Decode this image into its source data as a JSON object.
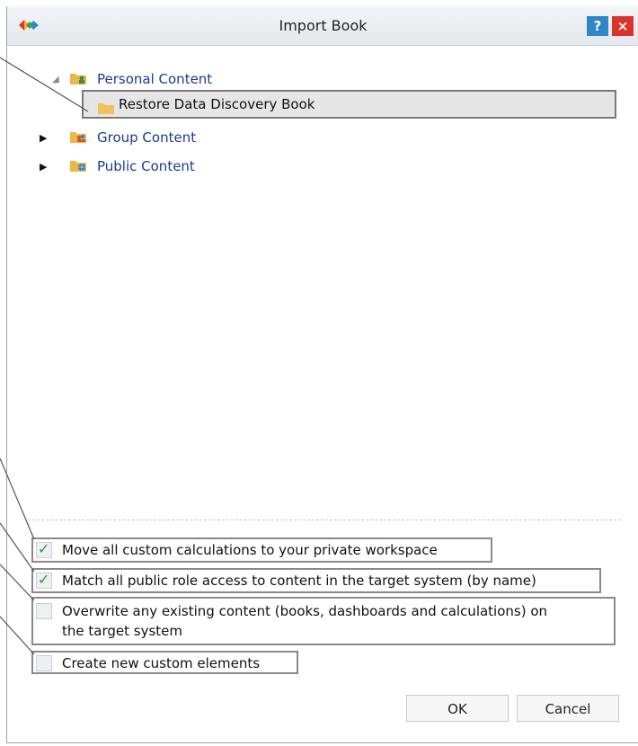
{
  "dialog": {
    "title": "Import Book"
  },
  "titlebar": {
    "help_label": "?",
    "close_label": "×"
  },
  "tree": {
    "items": [
      {
        "label": "Personal Content"
      },
      {
        "label": "Restore Data Discovery Book"
      },
      {
        "label": "Group Content"
      },
      {
        "label": "Public Content"
      }
    ]
  },
  "options": [
    {
      "label": "Move all custom calculations to your private workspace",
      "checked": true
    },
    {
      "label": "Match all public role access to content in the target system (by name)",
      "checked": true
    },
    {
      "label_line1": "Overwrite any existing content (books, dashboards and calculations) on",
      "label_line2": "the target system",
      "checked": false
    },
    {
      "label": "Create new custom elements",
      "checked": false
    }
  ],
  "buttons": {
    "ok": "OK",
    "cancel": "Cancel"
  },
  "colors": {
    "tree_link": "#1a3c8c",
    "help": "#2f86c9",
    "close": "#d9342b",
    "check": "#2e9a2e"
  }
}
